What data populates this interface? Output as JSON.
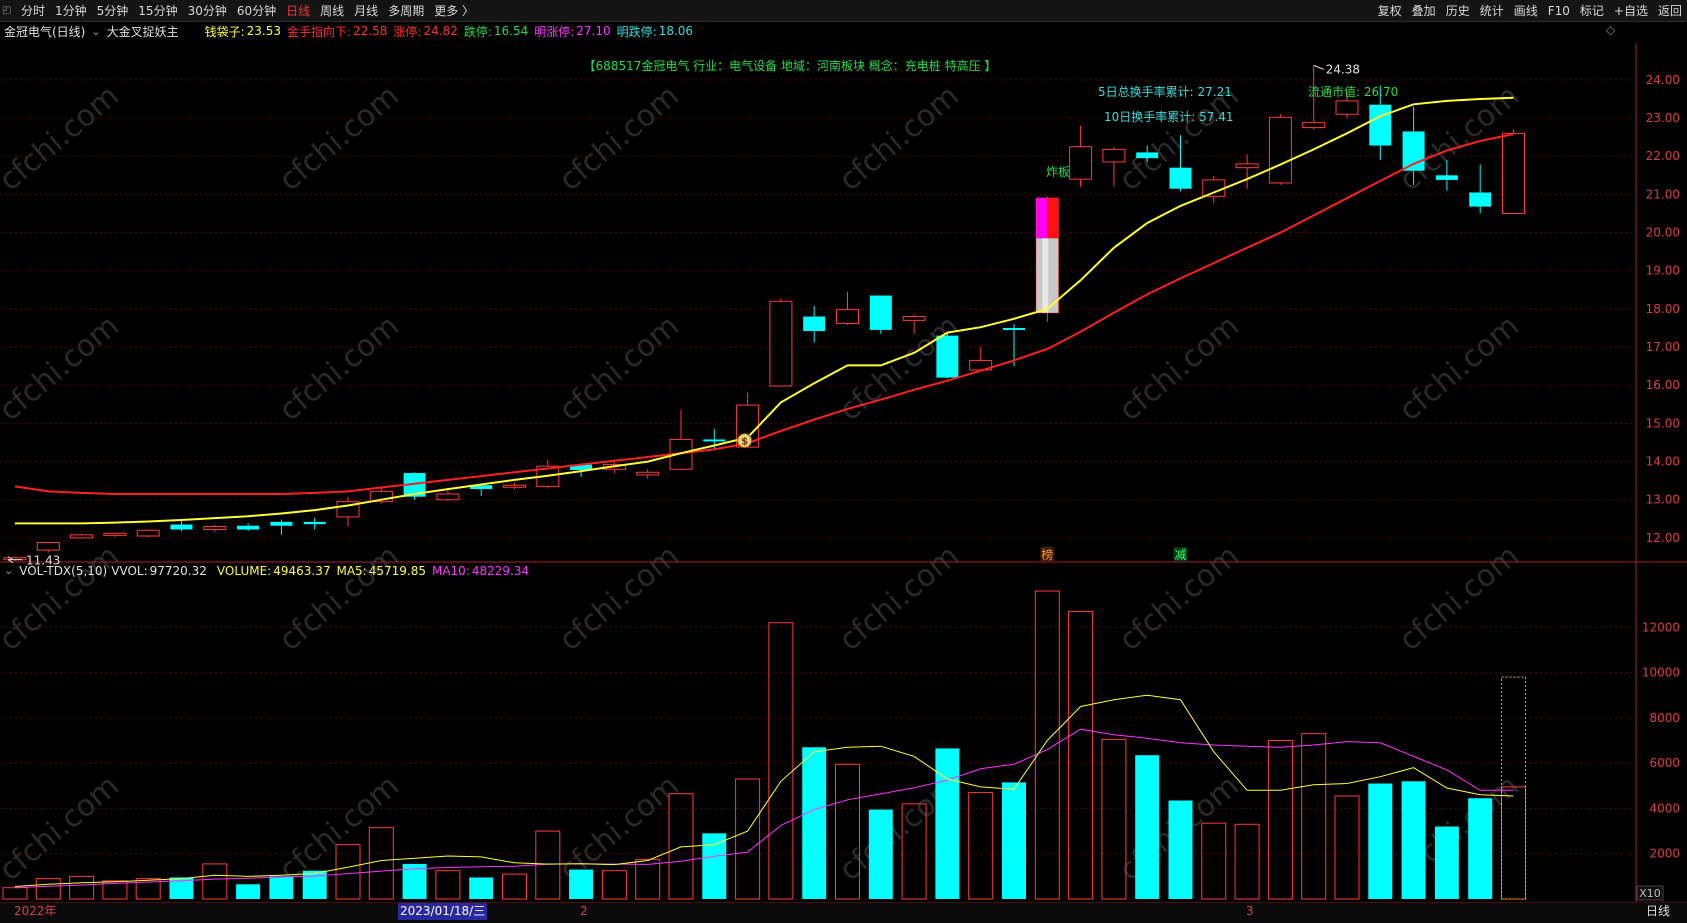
{
  "topbar": {
    "left_items": [
      {
        "label": "分时"
      },
      {
        "label": "1分钟"
      },
      {
        "label": "5分钟"
      },
      {
        "label": "15分钟"
      },
      {
        "label": "30分钟"
      },
      {
        "label": "60分钟"
      },
      {
        "label": "日线",
        "active": true
      },
      {
        "label": "周线"
      },
      {
        "label": "月线"
      },
      {
        "label": "多周期"
      },
      {
        "label": "更多 〉"
      }
    ],
    "right_items": [
      {
        "label": "复权"
      },
      {
        "label": "叠加"
      },
      {
        "label": "历史"
      },
      {
        "label": "统计"
      },
      {
        "label": "画线"
      },
      {
        "label": "F10"
      },
      {
        "label": "标记"
      },
      {
        "label": "+自选"
      },
      {
        "label": "返回"
      }
    ]
  },
  "info": {
    "stock_title": "金冠电气(日线)",
    "indicator_name": "大金叉捉妖主",
    "qdz_label": "钱袋子:",
    "qdz_value": "23.53",
    "jszb_label": "金手指向下:",
    "jszb_value": "22.58",
    "zt_label": "涨停:",
    "zt_value": "24.82",
    "dt_label": "跌停:",
    "dt_value": "16.54",
    "mzt_label": "明涨停:",
    "mzt_value": "27.10",
    "mdt_label": "明跌停:",
    "mdt_value": "18.06"
  },
  "colors": {
    "up": "#ff3b3b",
    "down": "#00ffff",
    "ma_fast": "#ffff33",
    "ma_slow": "#ff2020",
    "grid": "#5a0000",
    "axis": "#aa2222",
    "tick": "#d84040",
    "info_green": "#22dd44",
    "info_cyan": "#33dddd",
    "magenta": "#ff33ff",
    "yellow": "#ffff33",
    "watermark": "#2a2a2a"
  },
  "annotations": {
    "company_info": "【688517金冠电气  行业：电气设备  地域：河南板块  概念：充电桩 特高压 】",
    "turnover_5": "5日总换手率累计: 27.21",
    "turnover_10": "10日换手率累计: 57.41",
    "float_cap": "流通市值: 26.70",
    "zhaban": "炸板",
    "high_label": "24.38",
    "low_label": "11.43",
    "bang": "榜",
    "jian": "减",
    "coin": "$"
  },
  "volume_info": {
    "name": "VOL-TDX(5,10)",
    "vvol_label": "VVOL:",
    "vvol_value": "97720.32",
    "volume_label": "VOLUME:",
    "volume_value": "49463.37",
    "ma5_label": "MA5:",
    "ma5_value": "45719.85",
    "ma10_label": "MA10:",
    "ma10_value": "48229.34"
  },
  "watermark": "cfchi.com",
  "bottom": {
    "year_label": "2022年",
    "date_label": "2023/01/18/三",
    "month2": "2",
    "month3": "3",
    "period": "日线",
    "multiplier": "X10"
  },
  "chart_data": [
    {
      "type": "candlestick",
      "ylim": [
        11.5,
        24.6
      ],
      "yticks": [
        12.0,
        13.0,
        14.0,
        15.0,
        16.0,
        17.0,
        18.0,
        19.0,
        20.0,
        21.0,
        22.0,
        23.0,
        24.0
      ],
      "candles": [
        {
          "o": 11.45,
          "h": 11.52,
          "l": 11.4,
          "c": 11.48
        },
        {
          "o": 11.68,
          "h": 11.9,
          "l": 11.62,
          "c": 11.88
        },
        {
          "o": 12.0,
          "h": 12.12,
          "l": 11.98,
          "c": 12.08
        },
        {
          "o": 12.07,
          "h": 12.14,
          "l": 12.03,
          "c": 12.12
        },
        {
          "o": 12.05,
          "h": 12.22,
          "l": 12.02,
          "c": 12.2
        },
        {
          "o": 12.35,
          "h": 12.5,
          "l": 12.18,
          "c": 12.22
        },
        {
          "o": 12.22,
          "h": 12.35,
          "l": 12.15,
          "c": 12.3
        },
        {
          "o": 12.32,
          "h": 12.38,
          "l": 12.18,
          "c": 12.22
        },
        {
          "o": 12.42,
          "h": 12.48,
          "l": 12.08,
          "c": 12.32
        },
        {
          "o": 12.42,
          "h": 12.52,
          "l": 12.22,
          "c": 12.36
        },
        {
          "o": 12.55,
          "h": 13.08,
          "l": 12.3,
          "c": 12.95
        },
        {
          "o": 12.95,
          "h": 13.35,
          "l": 12.9,
          "c": 13.22
        },
        {
          "o": 13.7,
          "h": 13.72,
          "l": 13.0,
          "c": 13.08
        },
        {
          "o": 13.0,
          "h": 13.3,
          "l": 12.96,
          "c": 13.15
        },
        {
          "o": 13.38,
          "h": 13.4,
          "l": 13.1,
          "c": 13.28
        },
        {
          "o": 13.35,
          "h": 13.45,
          "l": 13.28,
          "c": 13.38
        },
        {
          "o": 13.35,
          "h": 14.05,
          "l": 13.3,
          "c": 13.88
        },
        {
          "o": 13.92,
          "h": 13.95,
          "l": 13.6,
          "c": 13.78
        },
        {
          "o": 13.8,
          "h": 13.98,
          "l": 13.7,
          "c": 13.92
        },
        {
          "o": 13.65,
          "h": 13.8,
          "l": 13.55,
          "c": 13.72
        },
        {
          "o": 13.8,
          "h": 15.35,
          "l": 13.78,
          "c": 14.58
        },
        {
          "o": 14.58,
          "h": 14.85,
          "l": 14.3,
          "c": 14.55
        },
        {
          "o": 14.38,
          "h": 15.8,
          "l": 14.35,
          "c": 15.48
        },
        {
          "o": 15.98,
          "h": 18.28,
          "l": 15.95,
          "c": 18.2
        },
        {
          "o": 17.8,
          "h": 18.08,
          "l": 17.12,
          "c": 17.42
        },
        {
          "o": 17.62,
          "h": 18.45,
          "l": 17.58,
          "c": 17.98
        },
        {
          "o": 18.35,
          "h": 18.35,
          "l": 17.35,
          "c": 17.45
        },
        {
          "o": 17.7,
          "h": 17.85,
          "l": 17.35,
          "c": 17.8
        },
        {
          "o": 17.3,
          "h": 17.35,
          "l": 16.18,
          "c": 16.2
        },
        {
          "o": 16.4,
          "h": 17.0,
          "l": 16.35,
          "c": 16.65
        },
        {
          "o": 17.5,
          "h": 17.6,
          "l": 16.5,
          "c": 17.48
        },
        {
          "o": 17.9,
          "h": 20.95,
          "l": 17.65,
          "c": 20.9
        },
        {
          "o": 21.4,
          "h": 22.8,
          "l": 21.2,
          "c": 22.25
        },
        {
          "o": 21.85,
          "h": 22.25,
          "l": 21.2,
          "c": 22.18
        },
        {
          "o": 22.1,
          "h": 22.28,
          "l": 21.85,
          "c": 21.95
        },
        {
          "o": 21.7,
          "h": 22.55,
          "l": 21.08,
          "c": 21.15
        },
        {
          "o": 20.95,
          "h": 21.48,
          "l": 20.78,
          "c": 21.38
        },
        {
          "o": 21.7,
          "h": 22.05,
          "l": 21.15,
          "c": 21.8
        },
        {
          "o": 21.3,
          "h": 23.1,
          "l": 21.25,
          "c": 23.02
        },
        {
          "o": 22.75,
          "h": 24.38,
          "l": 22.7,
          "c": 22.88
        },
        {
          "o": 23.1,
          "h": 23.7,
          "l": 23.0,
          "c": 23.45
        },
        {
          "o": 23.35,
          "h": 23.85,
          "l": 21.9,
          "c": 22.28
        },
        {
          "o": 22.65,
          "h": 23.3,
          "l": 21.25,
          "c": 21.62
        },
        {
          "o": 21.5,
          "h": 21.9,
          "l": 21.1,
          "c": 21.38
        },
        {
          "o": 21.05,
          "h": 21.78,
          "l": 20.5,
          "c": 20.68
        },
        {
          "o": 20.5,
          "h": 22.7,
          "l": 20.48,
          "c": 22.6
        }
      ],
      "ma_fast": [
        12.38,
        12.38,
        12.38,
        12.4,
        12.43,
        12.47,
        12.52,
        12.57,
        12.64,
        12.73,
        12.85,
        13.0,
        13.15,
        13.28,
        13.4,
        13.52,
        13.63,
        13.75,
        13.88,
        14.0,
        14.22,
        14.42,
        14.63,
        15.55,
        16.05,
        16.52,
        16.52,
        16.85,
        17.38,
        17.52,
        17.74,
        18.0,
        18.75,
        19.6,
        20.25,
        20.7,
        21.05,
        21.4,
        21.78,
        22.18,
        22.6,
        23.05,
        23.36,
        23.45,
        23.5,
        23.53
      ],
      "ma_slow": [
        13.35,
        13.22,
        13.18,
        13.15,
        13.15,
        13.15,
        13.15,
        13.15,
        13.15,
        13.18,
        13.22,
        13.32,
        13.42,
        13.52,
        13.62,
        13.72,
        13.82,
        13.92,
        14.02,
        14.12,
        14.22,
        14.32,
        14.48,
        14.8,
        15.1,
        15.38,
        15.62,
        15.88,
        16.12,
        16.38,
        16.65,
        16.95,
        17.4,
        17.9,
        18.38,
        18.8,
        19.2,
        19.6,
        20.0,
        20.45,
        20.9,
        21.35,
        21.8,
        22.15,
        22.4,
        22.58
      ]
    },
    {
      "type": "bar",
      "ylim": [
        0,
        14000
      ],
      "yticks": [
        2000,
        4000,
        6000,
        8000,
        10000,
        12000
      ],
      "volumes": [
        500,
        900,
        1000,
        800,
        900,
        950,
        1550,
        650,
        1000,
        1250,
        2400,
        3150,
        1550,
        1250,
        950,
        1100,
        3000,
        1300,
        1250,
        1750,
        4650,
        2900,
        5300,
        12200,
        6700,
        5950,
        3950,
        4200,
        6650,
        4700,
        5150,
        13600,
        12700,
        7050,
        6350,
        4350,
        3350,
        3300,
        7000,
        7300,
        4550,
        5100,
        5200,
        3200,
        4450,
        4950
      ],
      "vol_ma5": [
        550,
        650,
        720,
        760,
        830,
        900,
        1050,
        1000,
        1050,
        1130,
        1400,
        1700,
        1800,
        1900,
        1860,
        1600,
        1540,
        1560,
        1520,
        1700,
        2300,
        2400,
        3000,
        5200,
        6500,
        6700,
        6750,
        6300,
        5300,
        4950,
        4850,
        7000,
        8500,
        8800,
        9000,
        8800,
        6500,
        4800,
        4800,
        5050,
        5100,
        5400,
        5800,
        4900,
        4600,
        4550
      ],
      "vol_ma10": [
        500,
        560,
        620,
        690,
        750,
        810,
        880,
        920,
        970,
        1010,
        1120,
        1230,
        1340,
        1390,
        1420,
        1450,
        1540,
        1560,
        1540,
        1530,
        1670,
        1890,
        2070,
        3250,
        3950,
        4380,
        4640,
        4910,
        5250,
        5750,
        5950,
        6600,
        7500,
        7250,
        7100,
        6900,
        6800,
        6750,
        6700,
        6800,
        6950,
        6900,
        6300,
        5700,
        4800,
        4800
      ],
      "last_bar_box": 9800
    }
  ]
}
